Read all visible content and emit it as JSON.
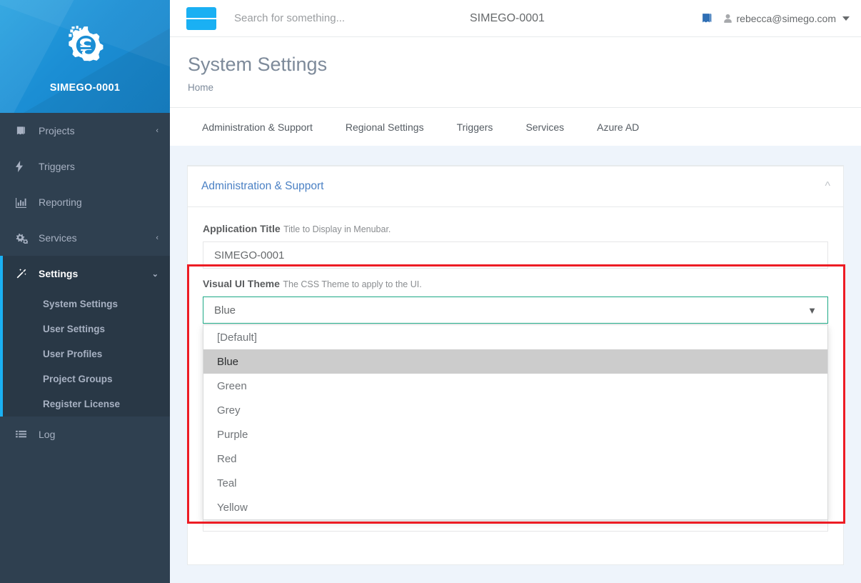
{
  "brand": {
    "name": "SIMEGO-0001",
    "logo_icon": "gear-s-logo"
  },
  "sidebar": {
    "items": [
      {
        "label": "Projects",
        "icon": "book-icon",
        "caret": "‹",
        "has_caret": true,
        "active": false
      },
      {
        "label": "Triggers",
        "icon": "bolt-icon",
        "caret": "",
        "has_caret": false,
        "active": false
      },
      {
        "label": "Reporting",
        "icon": "bar-chart-icon",
        "caret": "",
        "has_caret": false,
        "active": false
      },
      {
        "label": "Services",
        "icon": "cogs-icon",
        "caret": "‹",
        "has_caret": true,
        "active": false
      },
      {
        "label": "Settings",
        "icon": "magic-wand-icon",
        "caret": "⌄",
        "has_caret": true,
        "active": true
      }
    ],
    "sub_items": [
      {
        "label": "System Settings"
      },
      {
        "label": "User Settings"
      },
      {
        "label": "User Profiles"
      },
      {
        "label": "Project Groups"
      },
      {
        "label": "Register License"
      }
    ],
    "footer_item": {
      "label": "Log",
      "icon": "list-icon"
    }
  },
  "topbar": {
    "menu_toggle_icon": "hamburger-icon",
    "search_placeholder": "Search for something...",
    "search_value": "",
    "title": "SIMEGO-0001",
    "docs_icon": "book-icon",
    "user_icon": "user-icon",
    "user_email": "rebecca@simego.com",
    "caret_icon": "caret-down-icon"
  },
  "page": {
    "title": "System Settings",
    "breadcrumb": "Home"
  },
  "tabs": [
    {
      "label": "Administration & Support",
      "active": true
    },
    {
      "label": "Regional Settings",
      "active": false
    },
    {
      "label": "Triggers",
      "active": false
    },
    {
      "label": "Services",
      "active": false
    },
    {
      "label": "Azure AD",
      "active": false
    }
  ],
  "panel": {
    "title": "Administration & Support",
    "collapse_icon": "chevron-up-icon",
    "fields": {
      "app_title": {
        "label": "Application Title",
        "hint": "Title to Display in Menubar.",
        "value": "SIMEGO-0001"
      },
      "visual_theme": {
        "label": "Visual UI Theme",
        "hint": "The CSS Theme to apply to the UI.",
        "value": "Blue",
        "chevron_icon": "chevron-down-icon",
        "options": [
          {
            "label": "[Default]",
            "selected": false
          },
          {
            "label": "Blue",
            "selected": true
          },
          {
            "label": "Green",
            "selected": false
          },
          {
            "label": "Grey",
            "selected": false
          },
          {
            "label": "Purple",
            "selected": false
          },
          {
            "label": "Red",
            "selected": false
          },
          {
            "label": "Teal",
            "selected": false
          },
          {
            "label": "Yellow",
            "selected": false
          }
        ]
      },
      "next_field": {
        "value": ""
      }
    }
  },
  "colors": {
    "sidebar_bg": "#2f4050",
    "sidebar_active_bg": "#293846",
    "brand_blue": "#1b8ed4",
    "accent_blue": "#1ab0f3",
    "panel_title": "#4a80c4",
    "select_border": "#1ca885",
    "highlight_red": "#ed1c24",
    "content_bg": "#eef4fb",
    "option_selected_bg": "#cccccc"
  }
}
